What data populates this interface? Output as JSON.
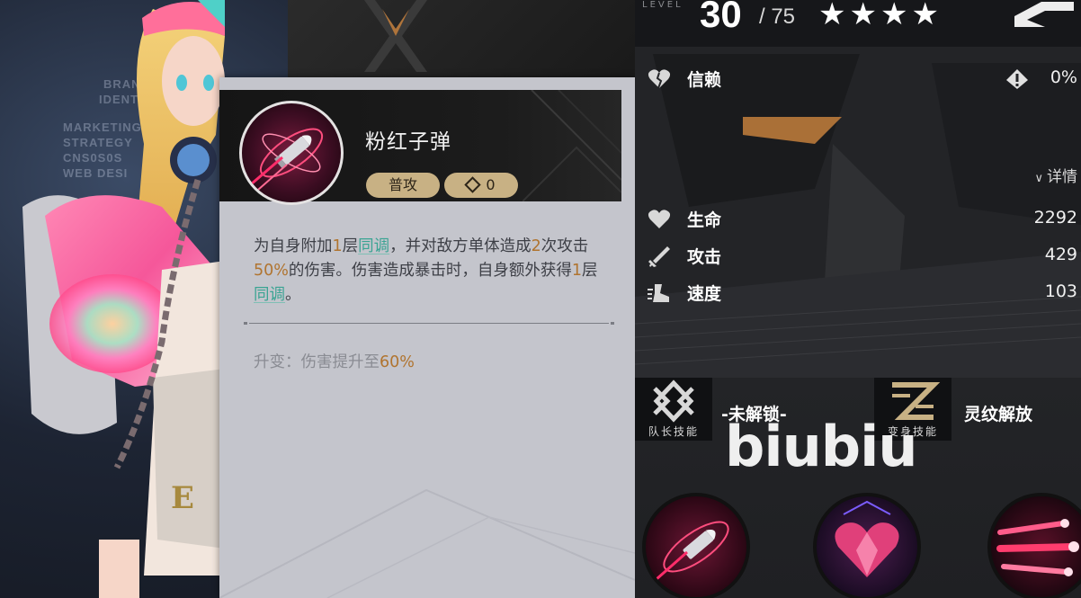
{
  "background_text": [
    "BRAND",
    "IDENTI",
    "MARKETING",
    "STRATEGY",
    "CNS0S0S",
    "WEB DESI"
  ],
  "skill_popup": {
    "name": "粉红子弹",
    "tag_type": "普攻",
    "tag_cost": "0",
    "description": {
      "p1": "为自身附加",
      "n1": "1",
      "p2": "层",
      "link1": "同调",
      "p3": "，并对敌方单体造成",
      "n2": "2",
      "p4": "次攻击",
      "n3": "50%",
      "p5": "的伤害。伤害造成暴击时，自身额外获得",
      "n4": "1",
      "p6": "层",
      "link2": "同调",
      "p7": "。"
    },
    "upgrade_prefix": "升变：伤害提升至",
    "upgrade_value": "60%"
  },
  "level": {
    "label": "LEVEL",
    "current": "30",
    "max": "/ 75",
    "stars": "★★★★"
  },
  "stats": {
    "trust_label": "信赖",
    "trust_value": "0%",
    "detail_label": "详情",
    "hp_label": "生命",
    "hp_value": "2292",
    "atk_label": "攻击",
    "atk_value": "429",
    "spd_label": "速度",
    "spd_value": "103"
  },
  "slots": {
    "leader_caption": "队长技能",
    "leader_status": "-未解锁-",
    "transform_caption": "变身技能",
    "transform_status": "灵纹解放"
  },
  "watermark": "biubiu",
  "colors": {
    "accent_gold": "#c8b184",
    "highlight_number": "#b0742f",
    "highlight_link": "#3aa493",
    "card_bg": "#c4c5cc"
  }
}
